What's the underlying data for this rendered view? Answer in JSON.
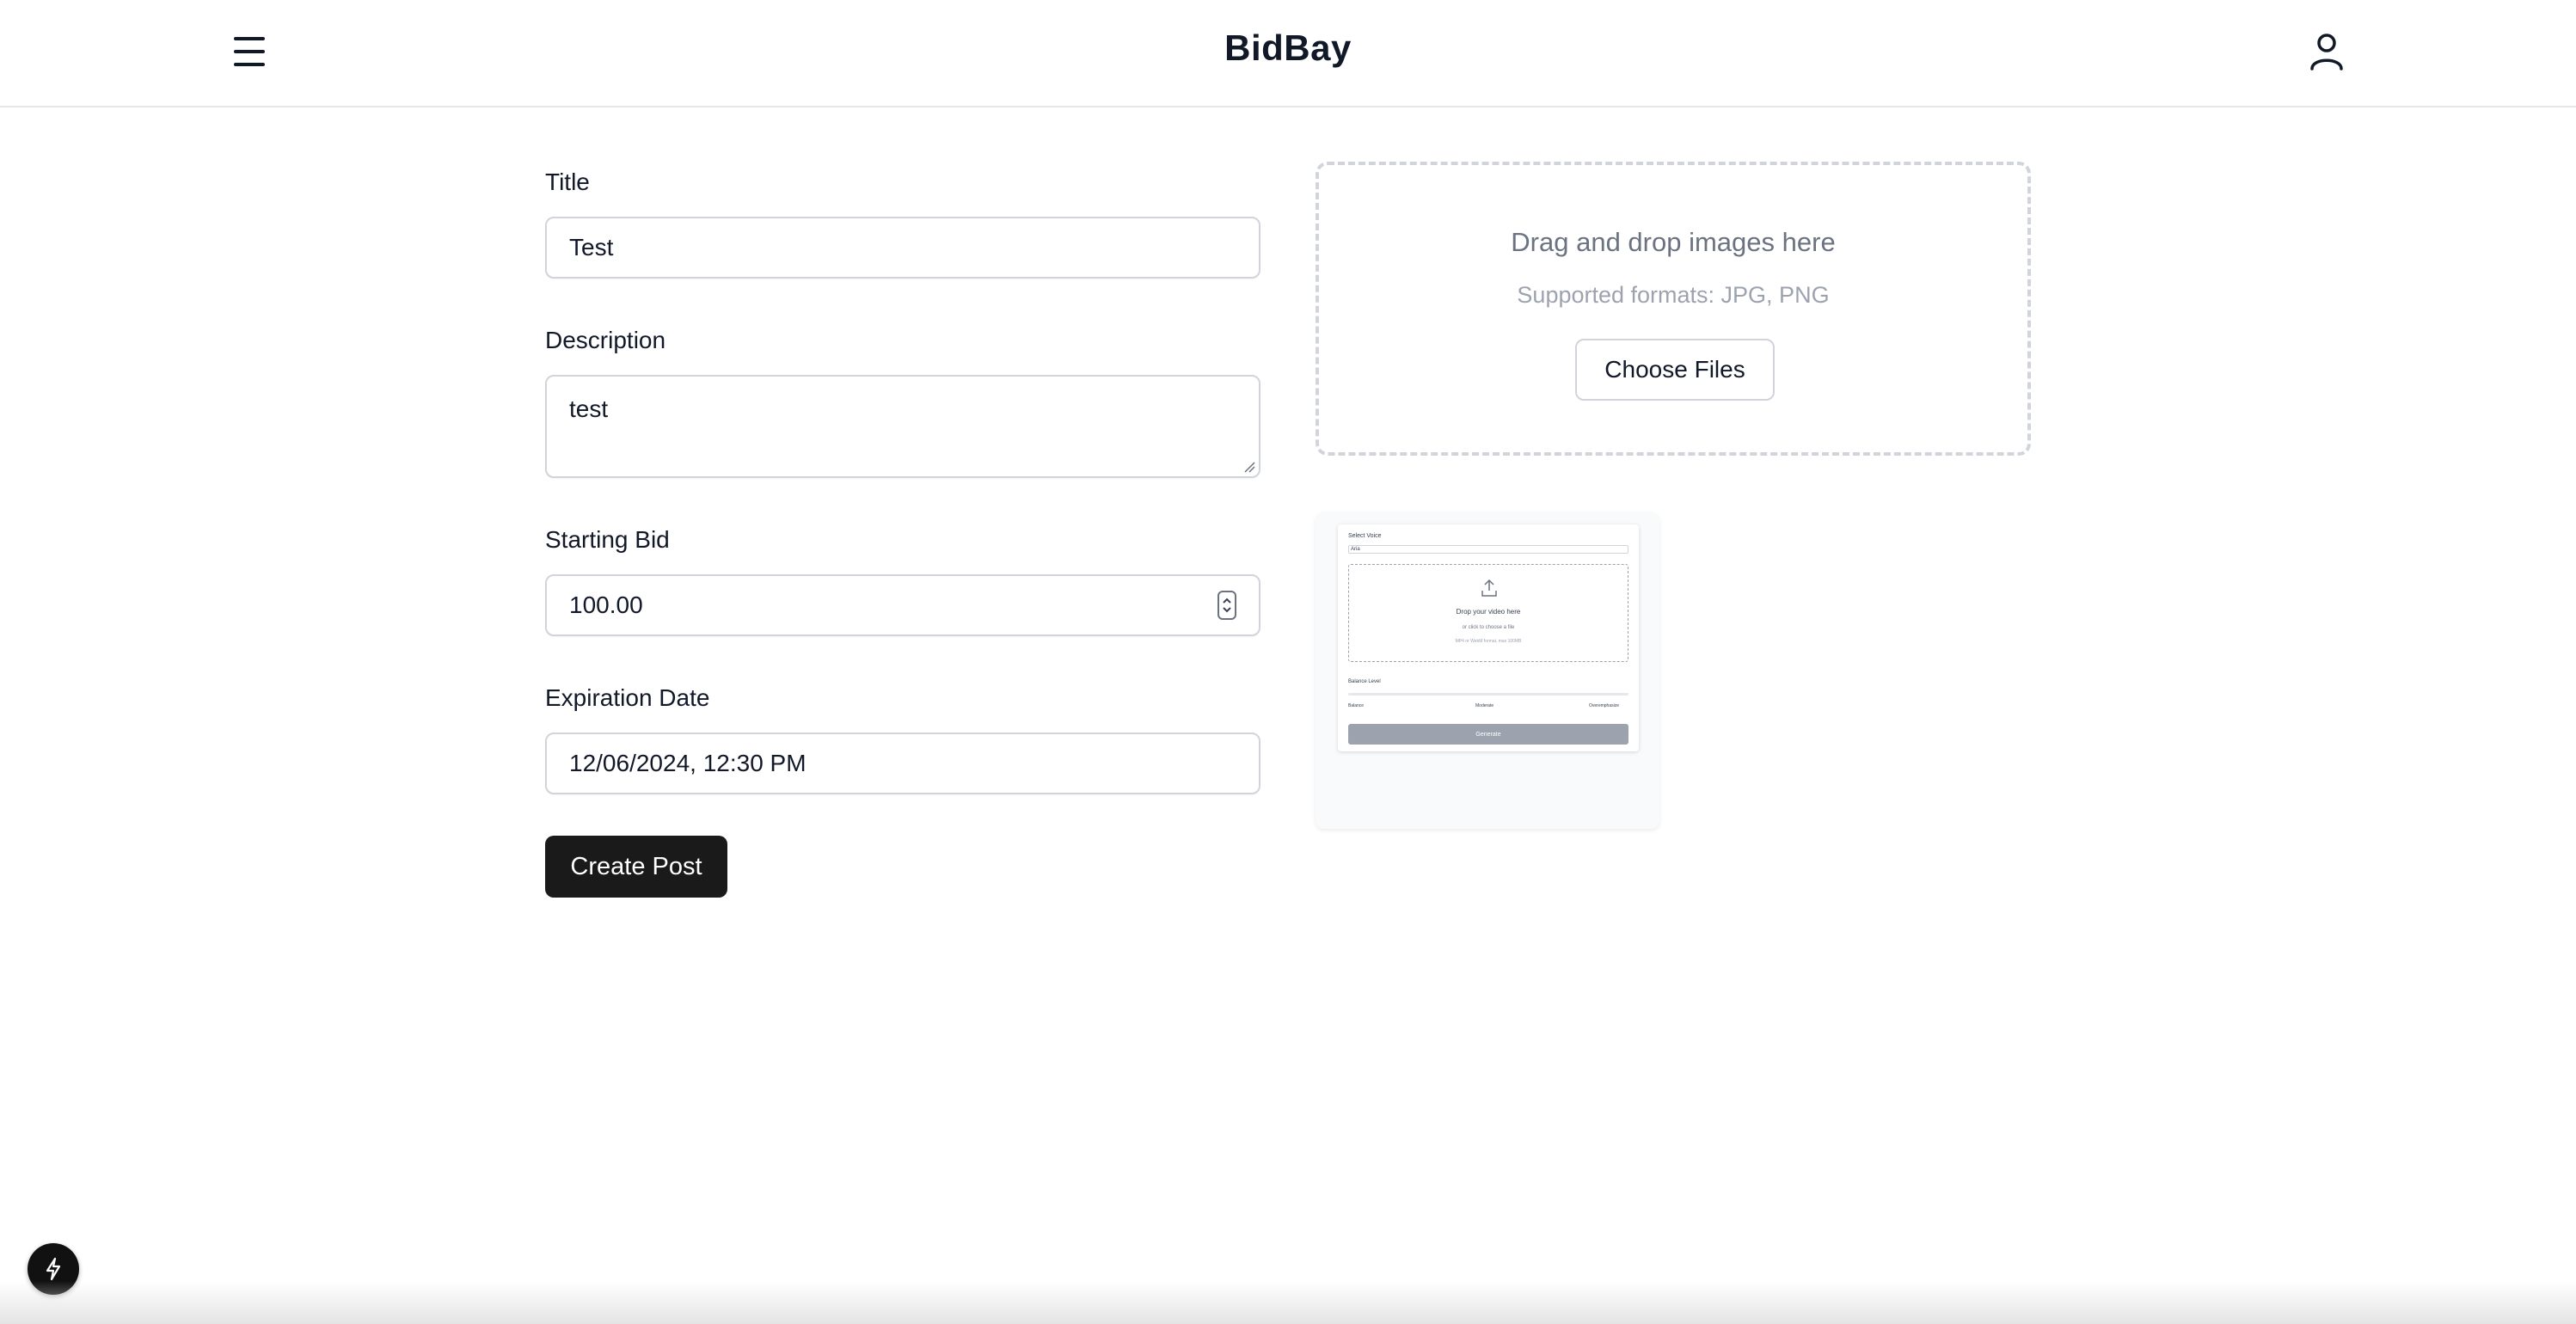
{
  "header": {
    "brand": "BidBay",
    "menu_icon": "hamburger-menu-icon",
    "user_icon": "user-icon"
  },
  "form": {
    "title_label": "Title",
    "title_value": "Test",
    "description_label": "Description",
    "description_value": "test",
    "starting_bid_label": "Starting Bid",
    "starting_bid_value": "100.00",
    "expiration_label": "Expiration Date",
    "expiration_value": "12/06/2024, 12:30 PM",
    "submit_label": "Create Post"
  },
  "upload": {
    "title": "Drag and drop images here",
    "subtitle": "Supported formats: JPG, PNG",
    "button_label": "Choose Files"
  },
  "preview": {
    "select_label": "Select Voice",
    "select_value": "Aria",
    "drop_title": "Drop your video here",
    "drop_sub": "or click to choose a file",
    "drop_hint": "MP4 or WebM format, max 100MB",
    "slider_label": "Balance Level",
    "slider_left": "Balance",
    "slider_mid": "Moderate",
    "slider_right": "Overemphasize",
    "button_label": "Generate"
  },
  "colors": {
    "primary_button": "#1a1a1a",
    "border": "#d1d5db",
    "muted_text": "#6b7280"
  }
}
